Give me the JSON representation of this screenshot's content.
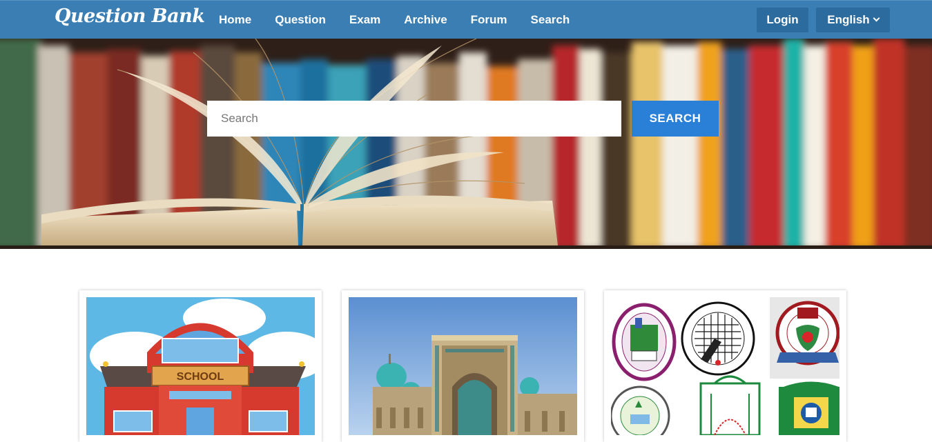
{
  "brand": "Question Bank",
  "nav": {
    "items": [
      "Home",
      "Question",
      "Exam",
      "Archive",
      "Forum",
      "Search"
    ],
    "login": "Login",
    "language": "English"
  },
  "hero": {
    "search_placeholder": "Search",
    "search_button": "SEARCH"
  },
  "cards": [
    {
      "name": "school",
      "sign_text": "SCHOOL"
    },
    {
      "name": "madrasa"
    },
    {
      "name": "education-boards"
    }
  ],
  "colors": {
    "navbar": "#3a7eb4",
    "nav_button": "#2b6b9d",
    "search_button": "#2a7fd6"
  }
}
